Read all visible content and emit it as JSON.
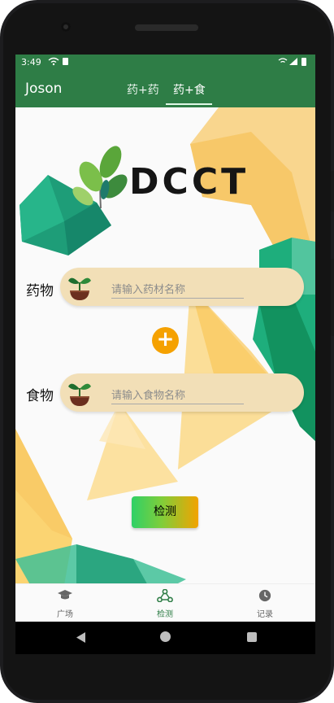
{
  "status_bar": {
    "time": "3:49"
  },
  "app_bar": {
    "user": "Joson",
    "tabs": [
      {
        "label": "药+药",
        "active": false
      },
      {
        "label": "药+食",
        "active": true
      }
    ]
  },
  "logo": {
    "text": "DCCT"
  },
  "drug_row": {
    "label": "药物",
    "placeholder": "请输入药材名称"
  },
  "food_row": {
    "label": "食物",
    "placeholder": "请输入食物名称"
  },
  "add_button": {
    "icon": "plus-icon"
  },
  "detect_button": {
    "label": "检测"
  },
  "bottom_nav": {
    "items": [
      {
        "label": "广场",
        "icon": "graduation-cap-icon",
        "active": false
      },
      {
        "label": "检测",
        "icon": "molecule-icon",
        "active": true
      },
      {
        "label": "记录",
        "icon": "clock-icon",
        "active": false
      }
    ]
  },
  "colors": {
    "primary": "#2e7d46",
    "accent": "#f5a100",
    "input_bg": "#f2dfb7"
  }
}
